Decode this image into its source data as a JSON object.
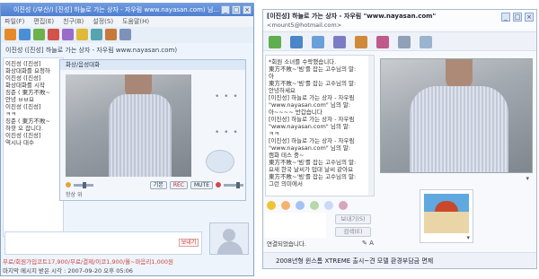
{
  "left_window": {
    "title": "이진성 (/부산/) [진성] 하늘로 가는 상자 - 자우림 www.nayasan.com) 님...",
    "controls": [
      "_",
      "□",
      "×"
    ],
    "menu": [
      "파일(F)",
      "편집(E)",
      "친구(B)",
      "설정(S)",
      "도움말(H)"
    ],
    "header_name": "이진성 ([진성] 하늘로 가는 상자 - 자우림 www.nayasan.com)",
    "chat_lines": [
      "이진성 ([진성]",
      "화상대화를 요청하",
      "",
      "이진성 ([진성]",
      "화상대화를 시작",
      "",
      "징준 ( 東方不敗~",
      "  안녕 ㅂㅂ요",
      "이진성 ([진성]",
      "  ㅋㅋ",
      "징준 ( 東方不敗~",
      "  하핫 오 잡니다.",
      "이진성 ([진성]",
      "  역시나 대수"
    ],
    "video_panel": {
      "title": "화상/음성대화",
      "dots_top": "• • •",
      "dots_mid": "• • •",
      "btn_default": "기본",
      "btn_rec": "REC",
      "btn_mute": "MUTE",
      "bottom_label": "항상 위"
    },
    "send_button": "보내기",
    "status_line": "무료/회원가입코트17,900/무료/결제/이코1,900/월~마음리1,000원",
    "last_message_time": "마지막 메시지 받은 시각 : 2007-09-20 오후 05:06"
  },
  "right_window": {
    "title": "[이진성] 하늘로 가는 상자 - 자우림 \"www.nayasan.com\"",
    "email": "<mount5@hotmail.com>",
    "chat_lines": [
      "*회원 소녀를 수락했습니다.",
      "東方不敗~'빔'를 잡는 고수님의 말:",
      "  아",
      "東方不敗~'빔'를 잡는 고수님의 말:",
      "  안녕하세요",
      "[이진성] 하늘로 가는 상자 - 자우림",
      "\"www.nayasan.com\" 님의 말:",
      "  아~~~~ 반갑습니다",
      "[이진성] 하늘로 가는 상자 - 자우림",
      "\"www.nayasan.com\" 님의 말:",
      "  ㅋㅋ",
      "[이진성] 하늘로 가는 상자 - 자우림",
      "\"www.nayasan.com\" 님의 말:",
      "  캠화 테스 중~",
      "東方不敗~'빔'를 잡는 고수님의 말:",
      "  요새 한국 날씨가 덥대 날씨 같아요",
      "東方不敗~'빔'를 잡는 고수님의 말:",
      "  그런 의미에서"
    ],
    "send_button": "보내기(S)",
    "search_button": "검색(E)",
    "status": "연결되었습니다.",
    "ad_text": "2008년형 윈스톰 XTREME 출시~견 모델 환경부담금 면제"
  }
}
